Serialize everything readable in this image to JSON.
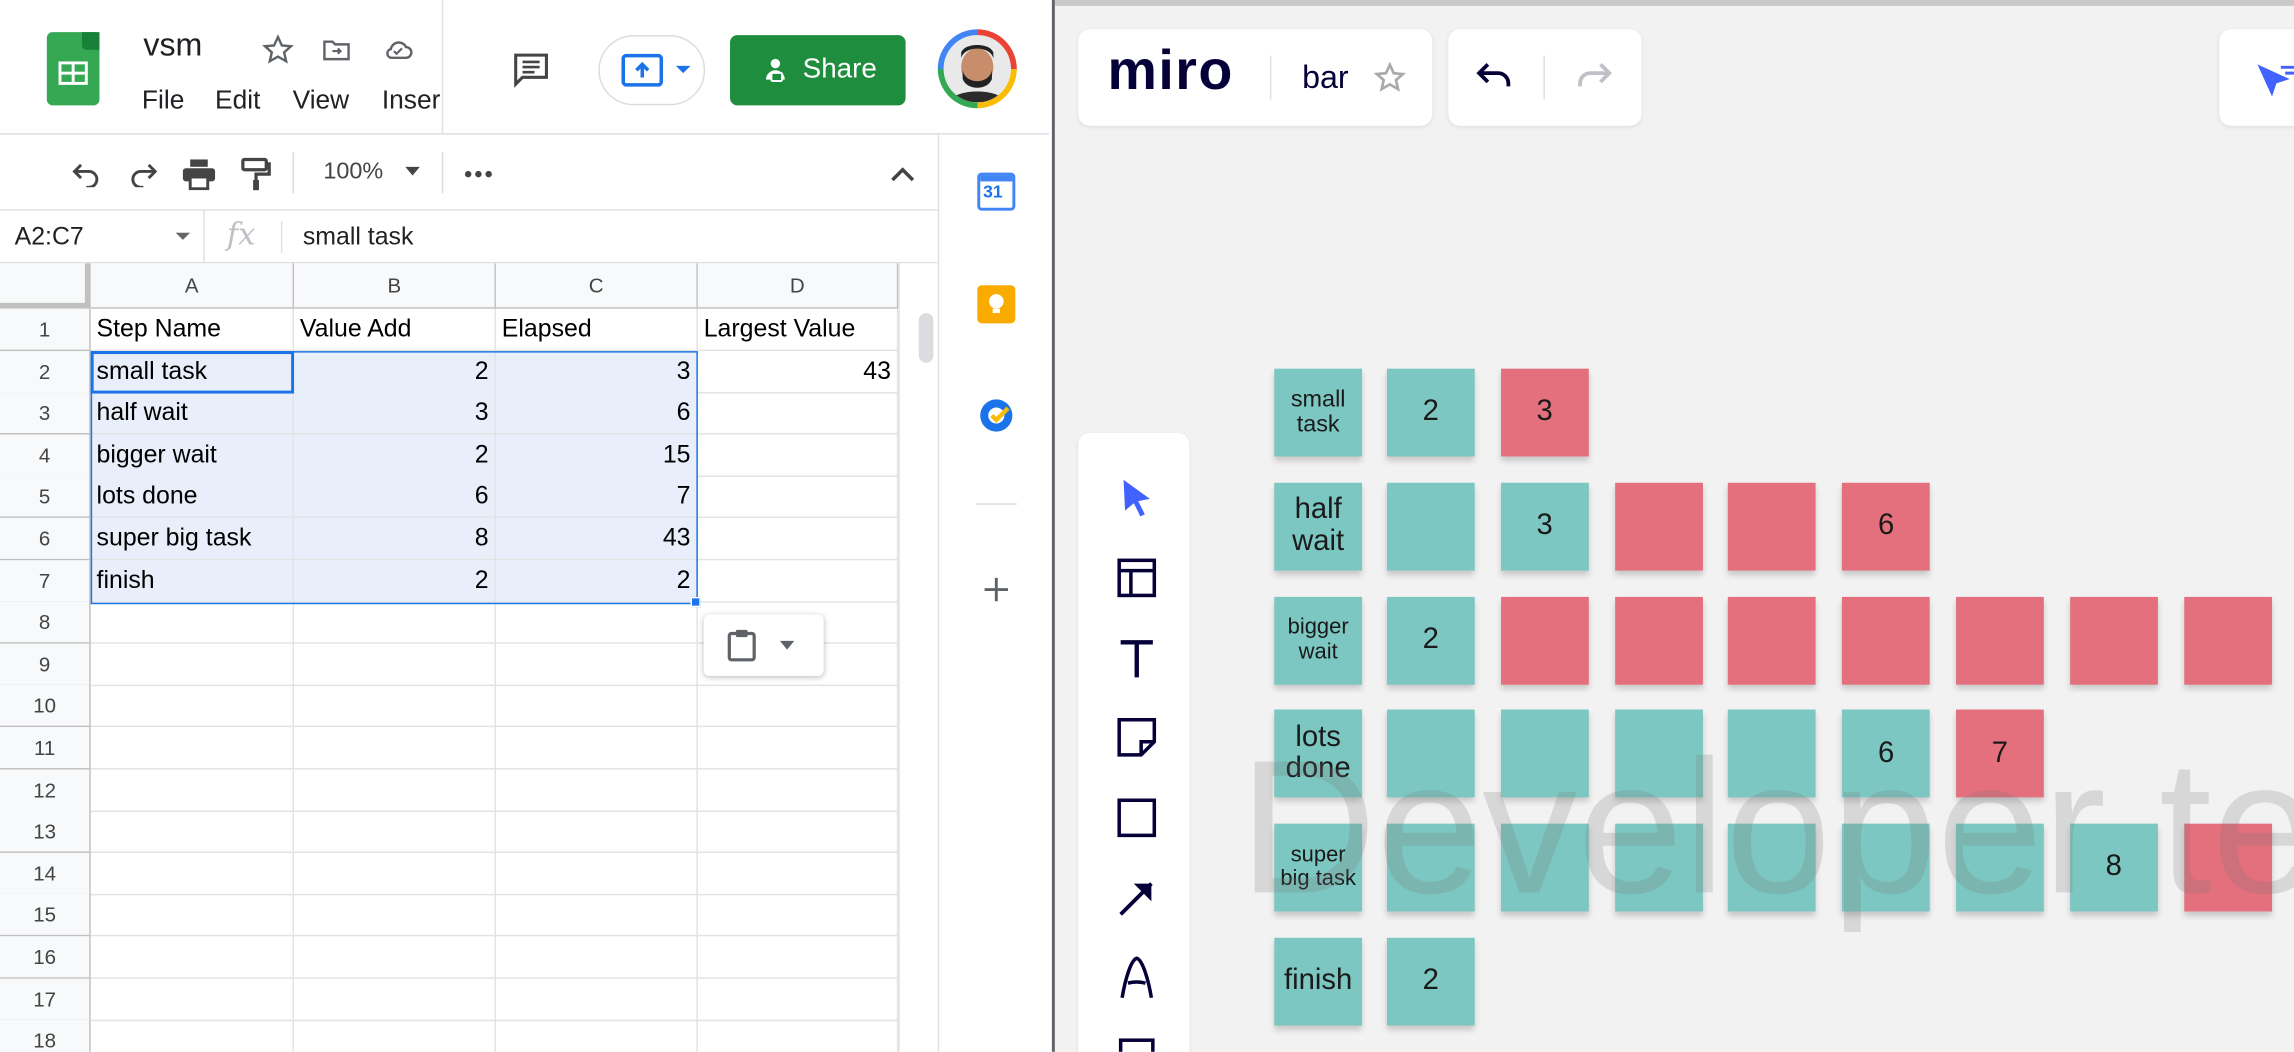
{
  "sheets": {
    "doc_name": "vsm",
    "menu": [
      "File",
      "Edit",
      "View",
      "Inser"
    ],
    "share_label": "Share",
    "zoom": "100%",
    "name_box": "A2:C7",
    "formula": "small task",
    "fx_label": "fx",
    "calendar_day": "31",
    "columns": [
      "A",
      "B",
      "C",
      "D"
    ],
    "rows": [
      "1",
      "2",
      "3",
      "4",
      "5",
      "6",
      "7",
      "8",
      "9",
      "10",
      "11",
      "12",
      "13",
      "14",
      "15",
      "16",
      "17",
      "18"
    ],
    "cells": [
      [
        "Step Name",
        "Value Add",
        "Elapsed",
        "Largest Value"
      ],
      [
        "small task",
        "2",
        "3",
        "43"
      ],
      [
        "half wait",
        "3",
        "6",
        ""
      ],
      [
        "bigger wait",
        "2",
        "15",
        ""
      ],
      [
        "lots done",
        "6",
        "7",
        ""
      ],
      [
        "super big task",
        "8",
        "43",
        ""
      ],
      [
        "finish",
        "2",
        "2",
        ""
      ]
    ]
  },
  "miro": {
    "logo": "miro",
    "board_name": "bar",
    "watermark": "Developer te",
    "tools": [
      "cursor-icon",
      "templates-icon",
      "text-icon",
      "sticky-note-icon",
      "shape-icon",
      "arrow-icon",
      "pen-icon"
    ],
    "board_rows": [
      {
        "label": "small task",
        "notes": [
          {
            "c": "teal",
            "t": "2"
          },
          {
            "c": "pink",
            "t": "3"
          }
        ]
      },
      {
        "label": "half wait",
        "notes": [
          {
            "c": "teal",
            "t": ""
          },
          {
            "c": "teal",
            "t": "3"
          },
          {
            "c": "pink",
            "t": ""
          },
          {
            "c": "pink",
            "t": ""
          },
          {
            "c": "pink",
            "t": "6"
          }
        ]
      },
      {
        "label": "bigger wait",
        "notes": [
          {
            "c": "teal",
            "t": "2"
          },
          {
            "c": "pink",
            "t": ""
          },
          {
            "c": "pink",
            "t": ""
          },
          {
            "c": "pink",
            "t": ""
          },
          {
            "c": "pink",
            "t": ""
          },
          {
            "c": "pink",
            "t": ""
          },
          {
            "c": "pink",
            "t": ""
          },
          {
            "c": "pink",
            "t": ""
          }
        ]
      },
      {
        "label": "lots done",
        "notes": [
          {
            "c": "teal",
            "t": ""
          },
          {
            "c": "teal",
            "t": ""
          },
          {
            "c": "teal",
            "t": ""
          },
          {
            "c": "teal",
            "t": ""
          },
          {
            "c": "teal",
            "t": "6"
          },
          {
            "c": "pink",
            "t": "7"
          }
        ]
      },
      {
        "label": "super big task",
        "notes": [
          {
            "c": "teal",
            "t": ""
          },
          {
            "c": "teal",
            "t": ""
          },
          {
            "c": "teal",
            "t": ""
          },
          {
            "c": "teal",
            "t": ""
          },
          {
            "c": "teal",
            "t": ""
          },
          {
            "c": "teal",
            "t": ""
          },
          {
            "c": "teal",
            "t": "8"
          },
          {
            "c": "pink",
            "t": ""
          }
        ]
      },
      {
        "label": "finish",
        "notes": [
          {
            "c": "teal",
            "t": "2"
          }
        ]
      }
    ]
  },
  "colors": {
    "teal": "#7cc7c1",
    "pink": "#e4707d",
    "share_green": "#1e8e3e",
    "selection": "#e8eefa"
  }
}
